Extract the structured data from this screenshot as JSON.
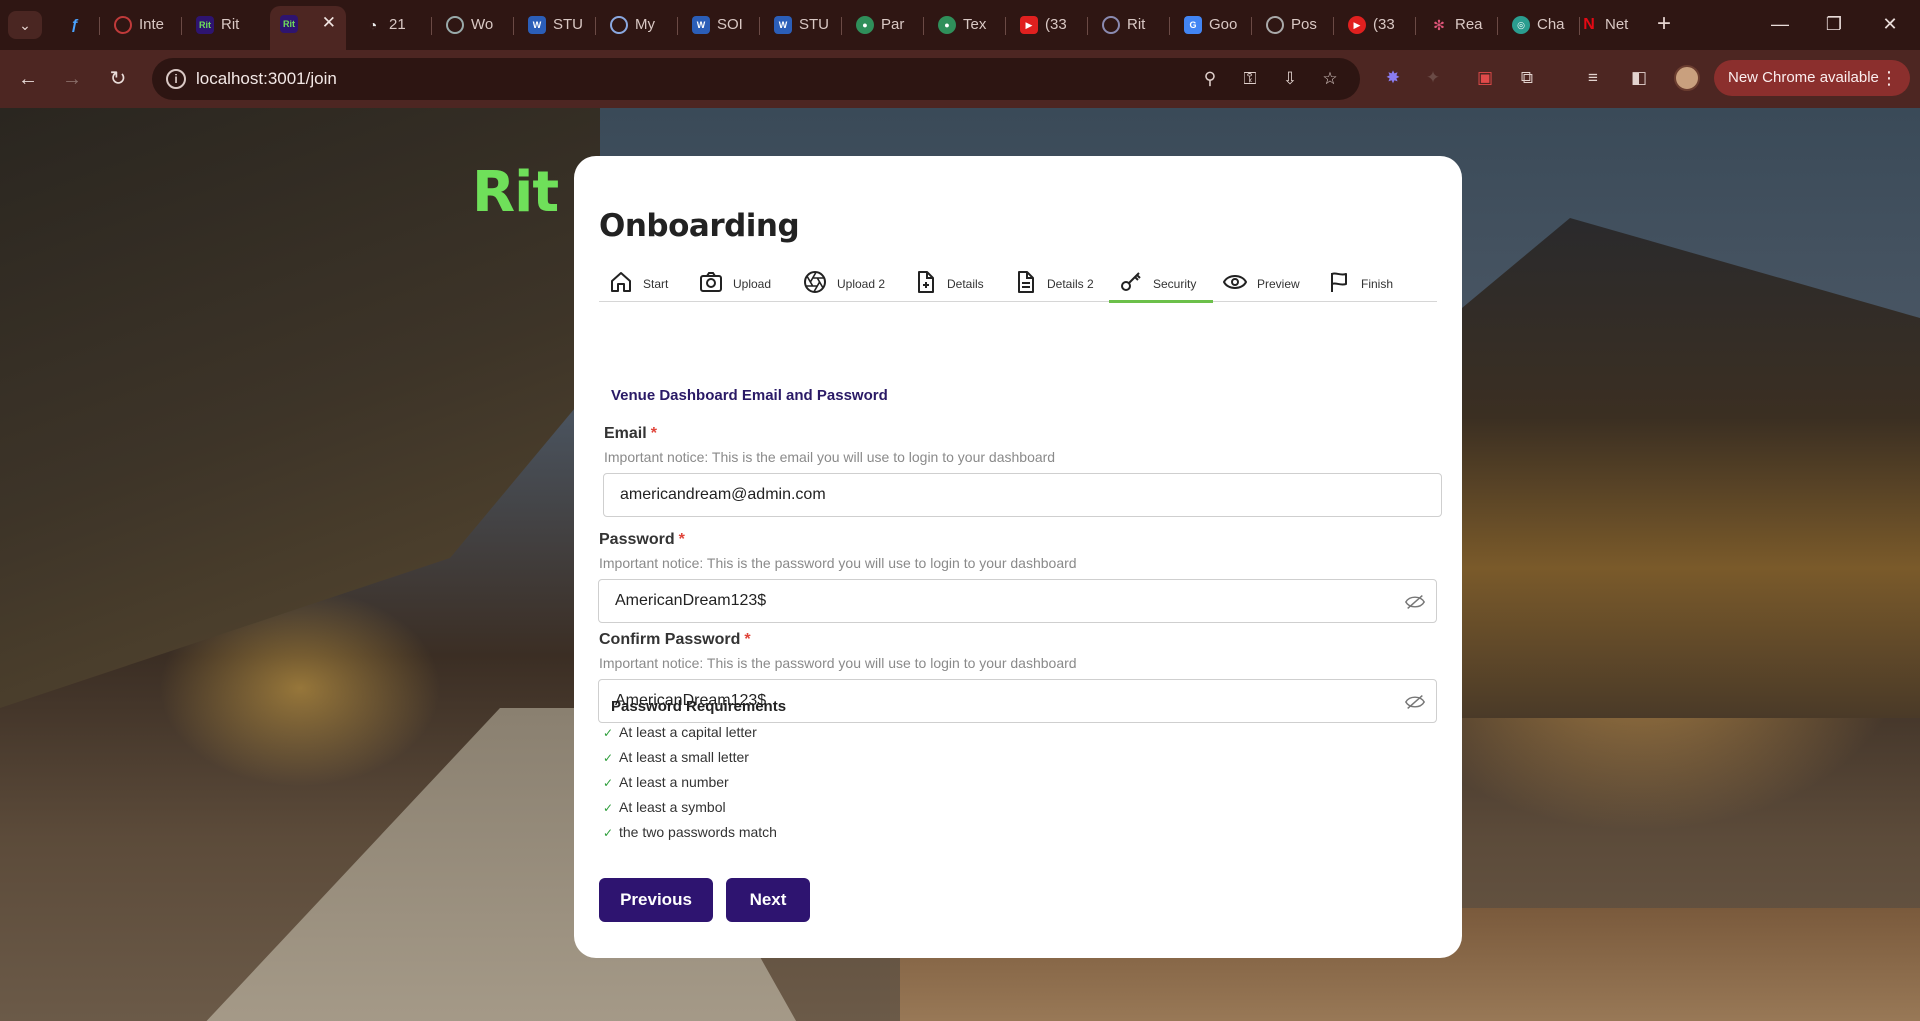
{
  "browser": {
    "tabs": [
      {
        "title": ""
      },
      {
        "title": "Inte"
      },
      {
        "title": "Rit"
      },
      {
        "title": ""
      },
      {
        "title": "21"
      },
      {
        "title": "Wo"
      },
      {
        "title": "STU"
      },
      {
        "title": "My"
      },
      {
        "title": "SOI"
      },
      {
        "title": "STU"
      },
      {
        "title": "Par"
      },
      {
        "title": "Tex"
      },
      {
        "title": "(33"
      },
      {
        "title": "Rit"
      },
      {
        "title": "Goo"
      },
      {
        "title": "Pos"
      },
      {
        "title": "(33"
      },
      {
        "title": "Rea"
      },
      {
        "title": "Cha"
      },
      {
        "title": "Net"
      }
    ],
    "url": "localhost:3001/join",
    "update_label": "New Chrome available"
  },
  "page": {
    "logo": "Rit",
    "title": "Onboarding",
    "steps": [
      {
        "label": "Start",
        "icon": "home-icon"
      },
      {
        "label": "Upload",
        "icon": "camera-icon"
      },
      {
        "label": "Upload 2",
        "icon": "aperture-icon"
      },
      {
        "label": "Details",
        "icon": "file-plus-icon"
      },
      {
        "label": "Details 2",
        "icon": "file-text-icon"
      },
      {
        "label": "Security",
        "icon": "key-icon"
      },
      {
        "label": "Preview",
        "icon": "eye-icon"
      },
      {
        "label": "Finish",
        "icon": "flag-icon"
      }
    ],
    "active_step": "Security",
    "section_title": "Venue Dashboard Email and Password",
    "email": {
      "label": "Email",
      "required_mark": "*",
      "notice": "Important notice: This is the email you will use to login to your dashboard",
      "value": "americandream@admin.com"
    },
    "password": {
      "label": "Password",
      "required_mark": "*",
      "notice": "Important notice: This is the password you will use to login to your dashboard",
      "value": "AmericanDream123$"
    },
    "confirm_password": {
      "label": "Confirm Password",
      "required_mark": "*",
      "notice": "Important notice: This is the password you will use to login to your dashboard",
      "value": "AmericanDream123$"
    },
    "requirements": {
      "title": "Password Requirements",
      "items": [
        "At least a capital letter",
        "At least a small letter",
        "At least a number",
        "At least a symbol",
        "the two passwords match"
      ]
    },
    "previous_label": "Previous",
    "next_label": "Next"
  },
  "colors": {
    "accent": "#2e1470",
    "logo": "#6fe05a",
    "active_step_underline": "#6cc04a",
    "required": "#e0443a",
    "check": "#2e9e3b"
  }
}
